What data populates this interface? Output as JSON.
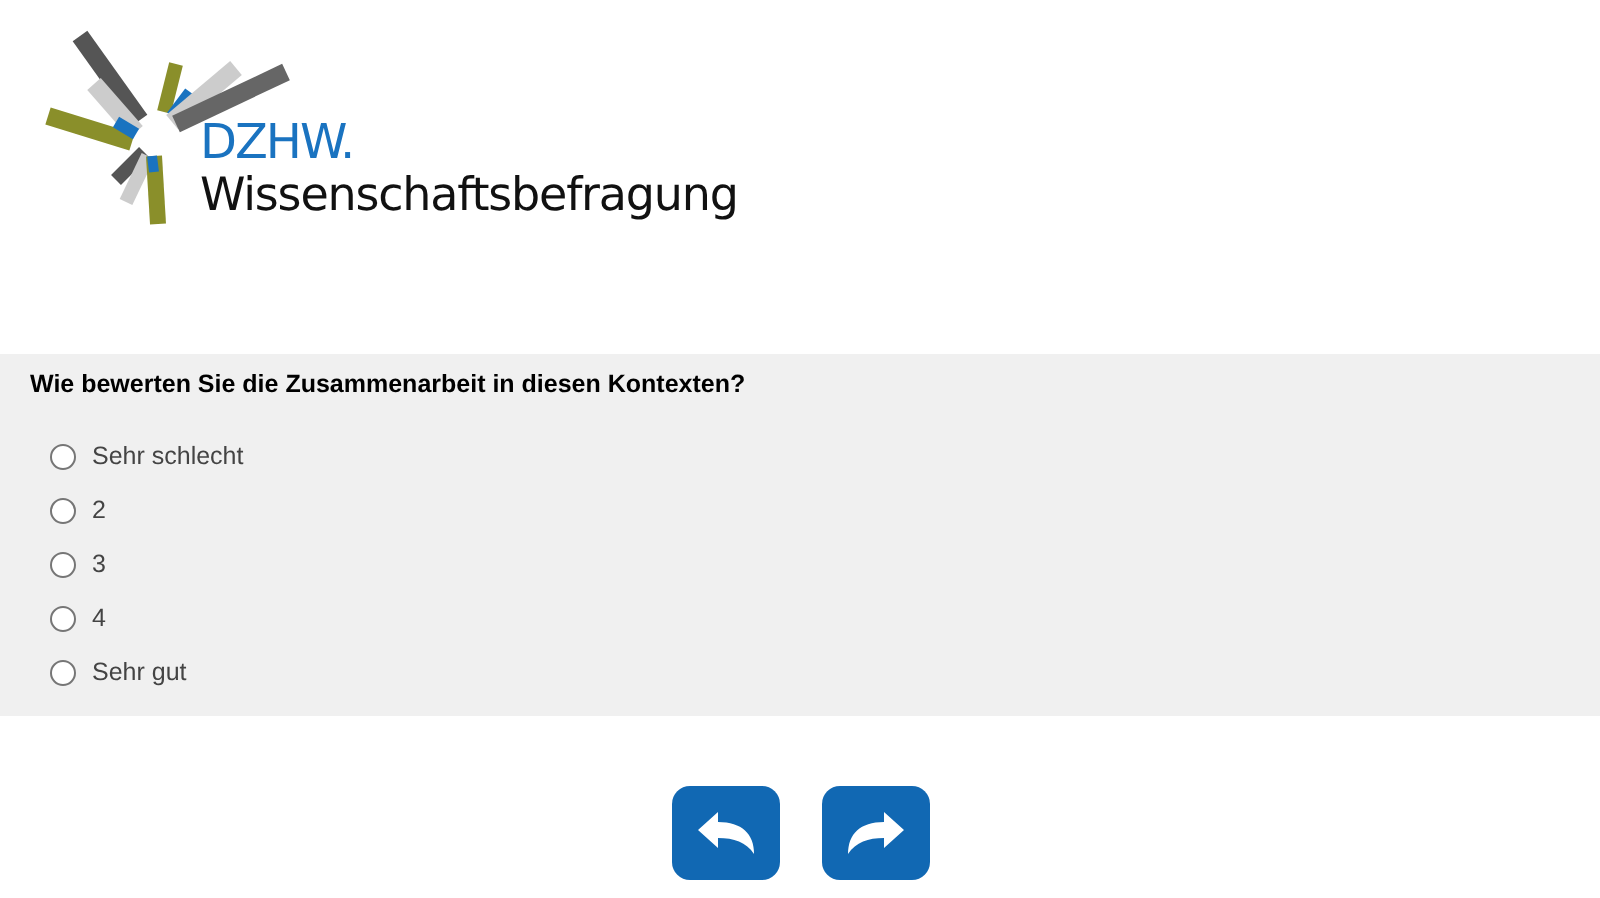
{
  "logo": {
    "brand": "DZHW.",
    "subtitle": "Wissenschaftsbefragung"
  },
  "question": {
    "text": "Wie bewerten Sie die Zusammenarbeit in diesen Kontexten?",
    "options": [
      {
        "label": "Sehr schlecht",
        "selected": false
      },
      {
        "label": "2",
        "selected": false
      },
      {
        "label": "3",
        "selected": false
      },
      {
        "label": "4",
        "selected": false
      },
      {
        "label": "Sehr gut",
        "selected": false
      }
    ]
  },
  "navigation": [
    {
      "kind": "back"
    },
    {
      "kind": "next"
    }
  ]
}
